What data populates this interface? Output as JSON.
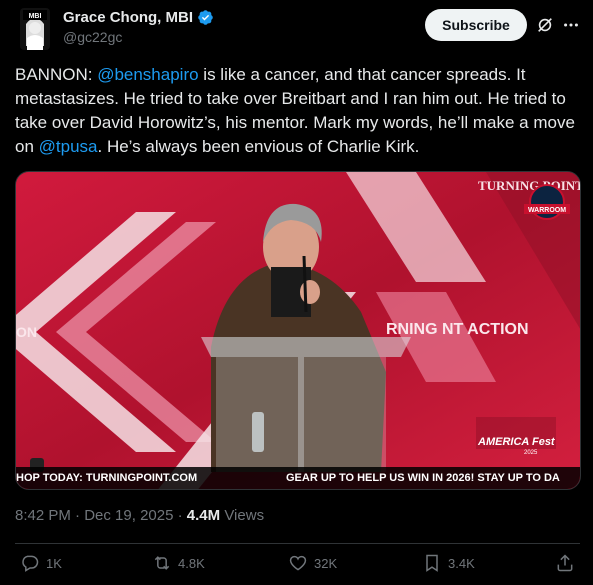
{
  "author": {
    "name": "Grace Chong, MBI",
    "handle": "@gc22gc",
    "avatar_label": "MBI",
    "verified": true
  },
  "header": {
    "subscribe_label": "Subscribe"
  },
  "tweet": {
    "text_parts": [
      {
        "text": "BANNON: ",
        "type": "text"
      },
      {
        "text": "@benshapiro",
        "type": "mention"
      },
      {
        "text": " is like a cancer, and that cancer spreads. It metastasizes. He tried to take over Breitbart and I ran him out. He tried to take over David Horowitz’s, his mentor. Mark my words, he’ll make a move on ",
        "type": "text"
      },
      {
        "text": "@tpusa",
        "type": "mention"
      },
      {
        "text": ". He’s always been envious of Charlie Kirk.",
        "type": "text"
      }
    ]
  },
  "media": {
    "ticker_left": "HOP TODAY: TURNINGPOINT.COM",
    "ticker_right": "GEAR UP TO HELP US WIN IN 2026! STAY UP TO DA",
    "overlay_top": "TURNING POINT ACTION",
    "overlay_mid": "RNING NT ACTION",
    "overlay_left": "ON",
    "badge": "WARROOM",
    "logo": "AMERICA Fest",
    "logo_year": "2025"
  },
  "meta": {
    "time": "8:42 PM",
    "sep1": " · ",
    "date": "Dec 19, 2025",
    "sep2": " · ",
    "views_count": "4.4M",
    "views_label": " Views"
  },
  "actions": {
    "replies": "1K",
    "reposts": "4.8K",
    "likes": "32K",
    "bookmarks": "3.4K"
  },
  "colors": {
    "accent": "#1d9bf0",
    "muted": "#71767b",
    "background": "#000000"
  }
}
